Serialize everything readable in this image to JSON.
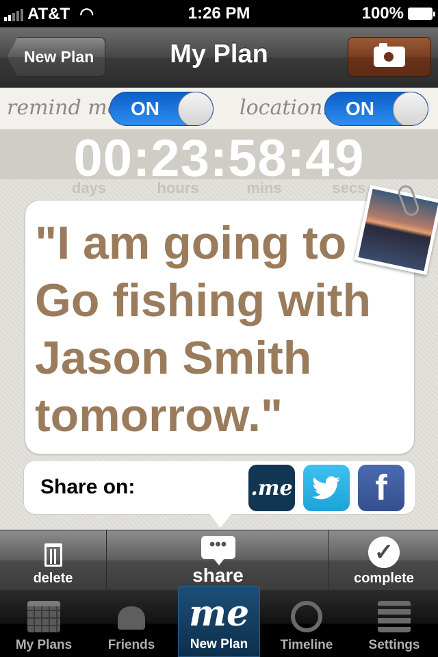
{
  "status_bar": {
    "carrier": "AT&T",
    "time": "1:26 PM",
    "battery": "100%"
  },
  "nav": {
    "back_label": "New Plan",
    "title": "My Plan",
    "camera_icon": "camera-icon"
  },
  "settings": {
    "remind_label": "remind me:",
    "remind_value": "ON",
    "location_label": "location:",
    "location_value": "ON"
  },
  "countdown": {
    "display": "00:23:58:49",
    "units": [
      "days",
      "hours",
      "mins",
      "secs"
    ]
  },
  "plan": {
    "quote": "\"I am going to Go fishing with Jason Smith tomorrow.\""
  },
  "share": {
    "label": "Share on:",
    "me": ".me",
    "twitter": "twitter-bird",
    "facebook": "f"
  },
  "actions": {
    "delete": "delete",
    "share": "share",
    "complete": "complete",
    "share_bubble": "•••"
  },
  "tabs": [
    {
      "label": "My Plans",
      "icon": "calendar-icon"
    },
    {
      "label": "Friends",
      "icon": "friends-icon"
    },
    {
      "label": "New Plan",
      "icon": "me-logo",
      "logo_text": "me"
    },
    {
      "label": "Timeline",
      "icon": "clock-icon"
    },
    {
      "label": "Settings",
      "icon": "list-icon"
    }
  ],
  "colors": {
    "accent_blue": "#1f78e0",
    "camera_brown": "#7a3f22",
    "quote_text": "#9a7c5c",
    "tab_active": "#1d4e78"
  }
}
